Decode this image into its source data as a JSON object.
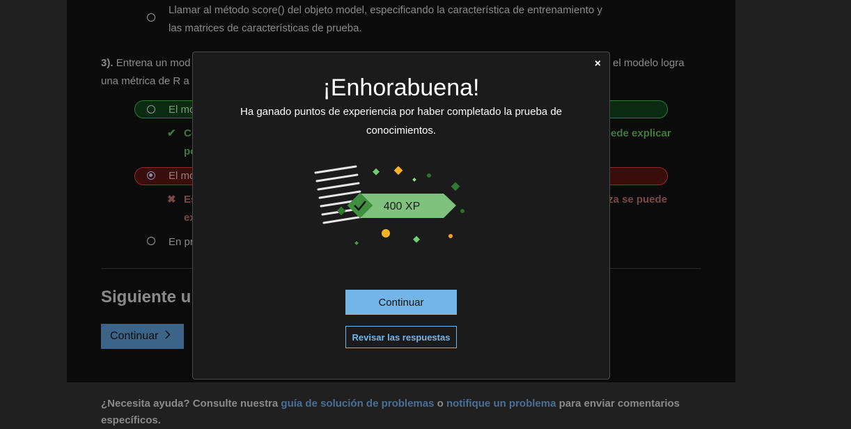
{
  "question2": {
    "option_text_line1": "Llamar al método score() del objeto model, especificando la característica de entrenamiento y",
    "option_text_line2": "las matrices de características de prueba."
  },
  "question3": {
    "number": "3).",
    "stem_left": "Entrena un mod",
    "stem_right": "el modelo logra",
    "stem_line2": "una métrica de R a",
    "option_correct_label": "El mo",
    "feedback_correct_left": "Co",
    "feedback_correct_right": "ede explicar",
    "feedback_correct_line2": "po",
    "option_wrong_label": "El mo",
    "feedback_wrong_left": "Es",
    "feedback_wrong_right": "za se puede",
    "feedback_wrong_line2": "ex",
    "option_last_label": "En pr"
  },
  "next_unit": {
    "title": "Siguiente ur",
    "button_label": "Continuar"
  },
  "footer": {
    "prefix": "¿Necesita ayuda? Consulte nuestra ",
    "link1": "guía de solución de problemas",
    "middle": " o ",
    "link2": "notifique un problema",
    "suffix": " para enviar comentarios específicos."
  },
  "modal": {
    "close_symbol": "×",
    "title": "¡Enhorabuena!",
    "subtitle": "Ha ganado puntos de experiencia por haber completado la prueba de conocimientos.",
    "xp_label": "400 XP",
    "primary_button": "Continuar",
    "secondary_button": "Revisar las respuestas"
  },
  "colors": {
    "accent": "#73b5e7",
    "xp_green": "#7ec27e",
    "success": "#2f7a37",
    "error": "#8b2b2b"
  }
}
